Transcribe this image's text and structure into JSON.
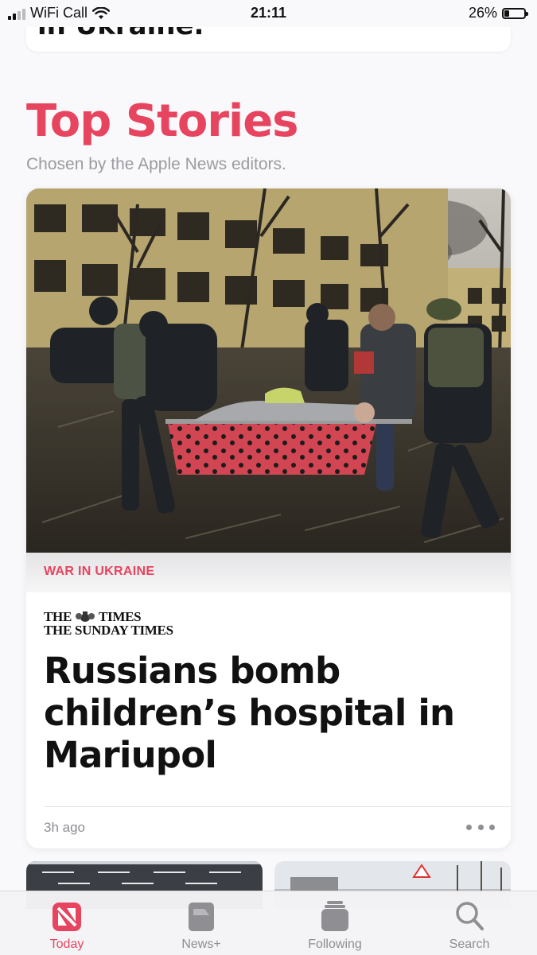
{
  "status_bar": {
    "carrier": "WiFi Call",
    "time": "21:11",
    "battery_percent": "26%",
    "battery_level": 0.26
  },
  "previous_card": {
    "partial_text": "in Ukraine."
  },
  "section": {
    "title": "Top Stories",
    "subtitle": "Chosen by the Apple News editors."
  },
  "story": {
    "image_icon": "war-photo-stretcher",
    "topic": "WAR IN UKRAINE",
    "publisher_line1": [
      "THE",
      "TIMES"
    ],
    "publisher_line2": "THE SUNDAY TIMES",
    "headline": "Russians bomb children’s hospital in Mariupol",
    "timestamp": "3h ago",
    "more_icon": "ellipsis-icon"
  },
  "tabs": [
    {
      "label": "Today",
      "icon": "news-logo-icon",
      "active": true
    },
    {
      "label": "News+",
      "icon": "magazine-icon",
      "active": false
    },
    {
      "label": "Following",
      "icon": "stacked-cards-icon",
      "active": false
    },
    {
      "label": "Search",
      "icon": "search-icon",
      "active": false
    }
  ],
  "colors": {
    "accent": "#e6445f",
    "secondary_text": "#8e8e93"
  }
}
